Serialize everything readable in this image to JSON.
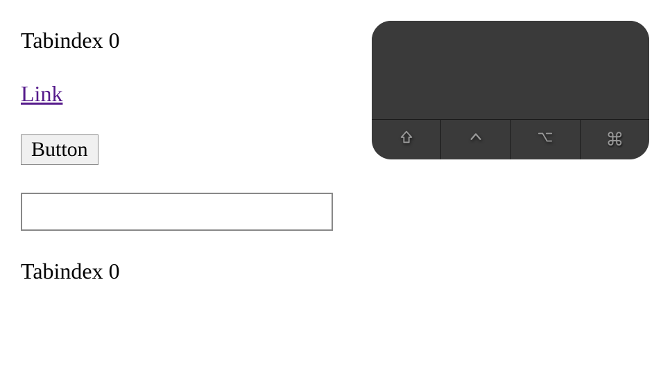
{
  "items": {
    "tabindex1": "Tabindex 0",
    "link": "Link",
    "button": "Button",
    "input_value": "",
    "tabindex2": "Tabindex 0"
  },
  "overlay": {
    "keys": {
      "shift": "shift",
      "control": "control",
      "option": "option",
      "command": "command"
    },
    "command_glyph": "⌘"
  }
}
